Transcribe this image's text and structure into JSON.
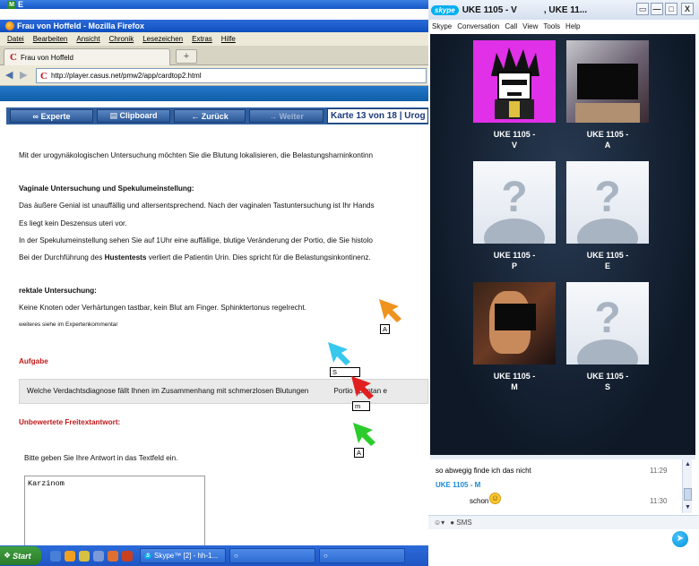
{
  "firefox": {
    "title_top": "M",
    "title_top_rest": "E",
    "title": "Frau von Hoffeld - Mozilla Firefox",
    "menu": [
      "Datei",
      "Bearbeiten",
      "Ansicht",
      "Chronik",
      "Lesezeichen",
      "Extras",
      "Hilfe"
    ],
    "tab_label": "Frau von Hoffeld",
    "tab_new": "+",
    "url": "http://player.casus.net/pmw2/app/cardtop2.html"
  },
  "toolbar": {
    "experte": "∞ Experte",
    "clipboard": "▤ Clipboard",
    "zurueck": "← Zurück",
    "weiter": "→ Weiter",
    "counter": "Karte 13 von 18 | Urog"
  },
  "content": {
    "intro": "Mit der urogynäkologischen Untersuchung möchten Sie die Blutung lokalisieren, die Belastungsharninkontinn",
    "vaginal_heading": "Vaginale Untersuchung und Spekulumeinstellung:",
    "vaginal_p1": "Das äußere Genial ist unauffällig und altersentsprechend. Nach der vaginalen Tastuntersuchung ist Ihr Hands",
    "vaginal_p2": "Es liegt kein Deszensus uteri vor.",
    "vaginal_p3": "In der Spekulumeinstellung sehen Sie auf 1Uhr eine auffällige, blutige Veränderung der Portio, die Sie histolo",
    "vaginal_p4_a": "Bei der Durchführung des ",
    "vaginal_p4_b": "Hustentests",
    "vaginal_p4_c": " verliert die Patientin Urin. Dies spricht für die Belastungsinkontinenz.",
    "rektal_heading": "rektale Untersuchung:",
    "rektal_p1": "Keine Knoten oder Verhärtungen tastbar, kein Blut am Finger. Sphinktertonus regelrecht.",
    "rektal_more": "weiteres siehe im Expertenkommentar",
    "aufgabe_heading": "Aufgabe",
    "aufgabe_text_a": "Welche Verdachtsdiagnose fällt Ihnen im Zusammenhang mit schmerzlosen Blutungen",
    "aufgabe_text_b": "Portio spontan e",
    "freitext_heading": "Unbewertete Freitextantwort:",
    "freitext_prompt": "Bitte geben Sie Ihre Antwort in das Textfeld ein.",
    "answer": "Karzinom"
  },
  "cursors": [
    {
      "label": "A",
      "color": "#f0921e"
    },
    {
      "label": "S",
      "color": "#38c8ee"
    },
    {
      "label": "m",
      "color": "#e02020"
    },
    {
      "label": "A",
      "color": "#2ccc2c"
    }
  ],
  "taskbar": {
    "start": "Start",
    "skype_task": "Skype™ [2] - hh-1...",
    "task_icon": "○"
  },
  "skype": {
    "logo": "skype",
    "title_a": "UKE 1105 - V",
    "title_b": ", UKE 11...",
    "win_min": "▭",
    "win_max": "—",
    "win_restore": "□",
    "win_close": "X",
    "menu": [
      "Skype",
      "Conversation",
      "Call",
      "View",
      "Tools",
      "Help"
    ],
    "participants": [
      {
        "name": "UKE 1105 -",
        "initial": "V"
      },
      {
        "name": "UKE 1105 -",
        "initial": "A"
      },
      {
        "name": "UKE 1105 -",
        "initial": "P"
      },
      {
        "name": "UKE 1105 -",
        "initial": "E"
      },
      {
        "name": "UKE 1105 -",
        "initial": "M"
      },
      {
        "name": "UKE 1105 -",
        "initial": "S"
      }
    ],
    "placeholder_glyph": "?",
    "chat": [
      {
        "text": "so abwegig finde ich das nicht",
        "time": "11:29"
      },
      {
        "sender": "UKE 1105 - M",
        "text": "schon",
        "time": "11:30"
      }
    ],
    "emoticon": "☺",
    "sms": "SMS",
    "send_glyph": "➤"
  }
}
